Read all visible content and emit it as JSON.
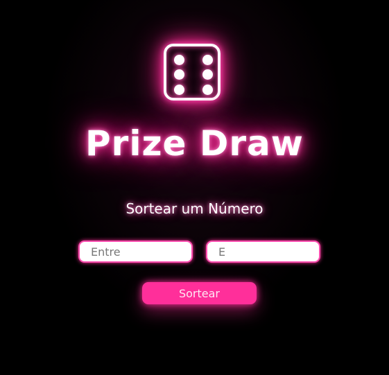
{
  "header": {
    "icon": "dice-six-icon",
    "title": "Prize Draw"
  },
  "main": {
    "subtitle": "Sortear um Número",
    "inputs": [
      {
        "placeholder": "Entre",
        "value": ""
      },
      {
        "placeholder": "E",
        "value": ""
      }
    ],
    "button_label": "Sortear"
  },
  "colors": {
    "background": "#000000",
    "neon_pink": "#ff2f9a",
    "text": "#ffffff"
  }
}
